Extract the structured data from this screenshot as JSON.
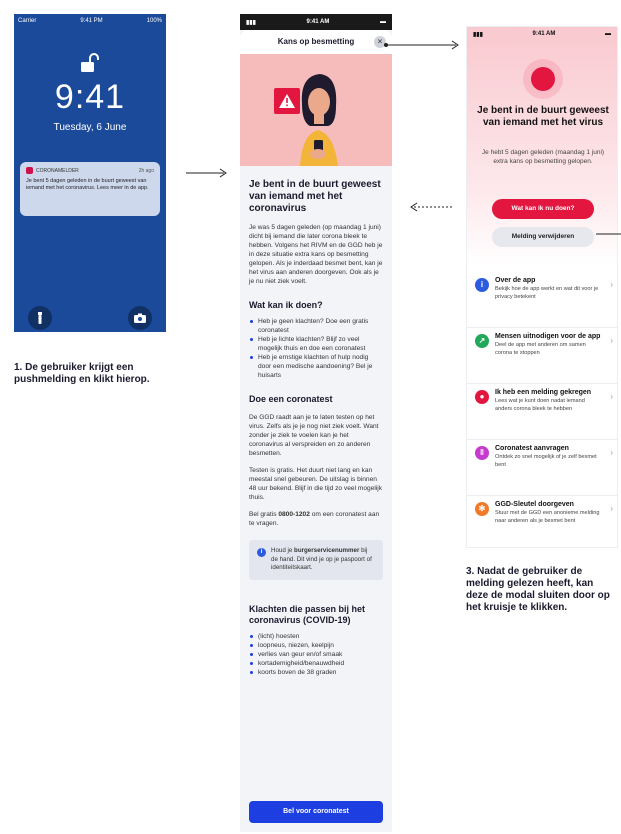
{
  "lock": {
    "carrier": "Carrier",
    "time_small": "9:41 PM",
    "battery": "100%",
    "time": "9:41",
    "date": "Tuesday, 6 June",
    "notification": {
      "app": "CORONAMELDER",
      "ago": "2h ago",
      "text": "Je bent 5 dagen geleden in de buurt geweest van iemand met het coronavirus. Lees meer in de app."
    }
  },
  "captions": {
    "step1": "1. De gebruiker krijgt een pushmelding en klikt hierop.",
    "step3": "3. Nadat de gebruiker de melding gelezen heeft, kan deze de modal sluiten door op het kruisje te klikken."
  },
  "modal": {
    "status_time": "9:41 AM",
    "title": "Kans op besmetting",
    "close": "×",
    "heading": "Je bent in de buurt geweest van iemand met het coronavirus",
    "intro": "Je was 5 dagen geleden (op maandag 1 juni) dicht bij iemand die later corona bleek te hebben. Volgens het RIVM en de GGD heb je in deze situatie extra kans op besmetting gelopen. Als je inderdaad besmet bent, kan je het virus aan anderen doorgeven. Ook als je je nu niet ziek voelt.",
    "what_heading": "Wat kan ik doen?",
    "what_items": [
      "Heb je geen klachten? Doe een gratis coronatest",
      "Heb je lichte klachten? Blijf zo veel mogelijk thuis en doe een coronatest",
      "Heb je ernstige klachten of hulp nodig door een medische aandoening? Bel je huisarts"
    ],
    "test_heading": "Doe een coronatest",
    "test_p1": "De GGD raadt aan je te laten testen op het virus. Zelfs als je je nog niet ziek voelt. Want zonder je ziek te voelen kan je het coronavirus al verspreiden en zo anderen besmetten.",
    "test_p2": "Testen is gratis. Het duurt niet lang en kan meestal snel gebeuren. De uitslag is binnen 48 uur bekend. Blijf in die tijd zo veel mogelijk thuis.",
    "call_pre": "Bel gratis ",
    "call_number": "0800-1202",
    "call_post": " om een coronatest aan te vragen.",
    "info_pre": "Houd je ",
    "info_bold": "burgerservicenummer",
    "info_post": " bij de hand. Dit vind je op je paspoort of identiteitskaart.",
    "symptoms_heading": "Klachten die passen bij het coronavirus (COVID-19)",
    "symptoms": [
      "(licht) hoesten",
      "loopneus, niezen, keelpijn",
      "verlies van geur en/of smaak",
      "kortademigheid/benauwdheid",
      "koorts boven de 38 graden"
    ],
    "cta": "Bel voor coronatest"
  },
  "home": {
    "status_time": "9:41 AM",
    "heading": "Je bent in de buurt geweest van iemand met het virus",
    "sub": "Je hebt 5 dagen geleden (maandag 1 juni) extra kans op besmetting gelopen.",
    "btn_primary": "Wat kan ik nu doen?",
    "btn_secondary": "Melding verwijderen",
    "items": [
      {
        "title": "Over de app",
        "desc": "Bekijk hoe de app werkt en wat dit voor je privacy betekent",
        "color": "#2c5be0",
        "icon": "i"
      },
      {
        "title": "Mensen uitnodigen voor de app",
        "desc": "Deel de app met anderen om samen corona te stoppen",
        "color": "#22a85a",
        "icon": "↗"
      },
      {
        "title": "Ik heb een melding gekregen",
        "desc": "Lees wat je kunt doen nadat iemand anders corona bleek te hebben",
        "color": "#e2163f",
        "icon": "●"
      },
      {
        "title": "Coronatest aanvragen",
        "desc": "Ontdek zo snel mogelijk of je zelf besmet bent",
        "color": "#c63ad0",
        "icon": "‖"
      },
      {
        "title": "GGD-Sleutel doorgeven",
        "desc": "Stuur met de GGD een anonieme melding naar anderen als je besmet bent",
        "color": "#f07a2a",
        "icon": "✻"
      }
    ]
  }
}
